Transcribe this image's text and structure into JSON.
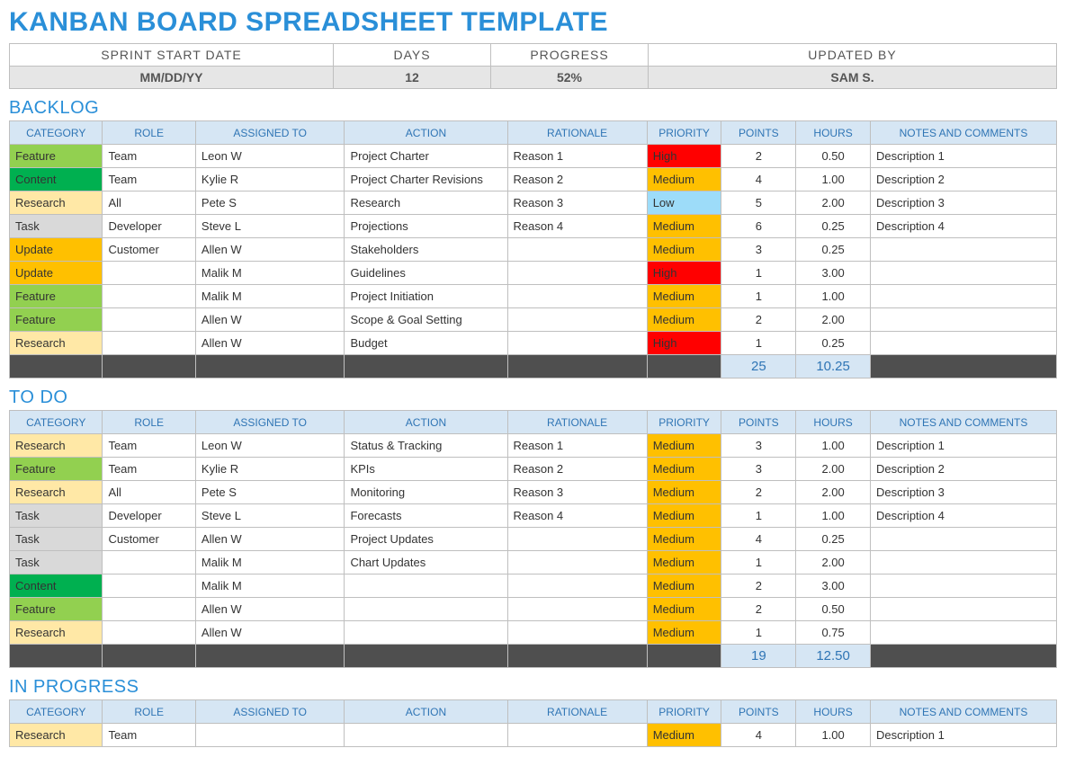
{
  "title": "KANBAN BOARD SPREADSHEET TEMPLATE",
  "meta": {
    "headers": [
      "SPRINT START DATE",
      "DAYS",
      "PROGRESS",
      "UPDATED BY"
    ],
    "values": [
      "MM/DD/YY",
      "12",
      "52%",
      "SAM S."
    ]
  },
  "columns": [
    "CATEGORY",
    "ROLE",
    "ASSIGNED TO",
    "ACTION",
    "RATIONALE",
    "PRIORITY",
    "POINTS",
    "HOURS",
    "NOTES AND COMMENTS"
  ],
  "categoryColors": {
    "Feature": "#92d050",
    "Content": "#00b050",
    "Research": "#ffe8a6",
    "Task": "#d9d9d9",
    "Update": "#ffc000"
  },
  "priorityColors": {
    "High": "#ff0000",
    "Medium": "#ffc000",
    "Low": "#9ddcf9"
  },
  "sections": [
    {
      "name": "BACKLOG",
      "rows": [
        {
          "category": "Feature",
          "role": "Team",
          "assigned": "Leon W",
          "action": "Project Charter",
          "rationale": "Reason 1",
          "priority": "High",
          "points": "2",
          "hours": "0.50",
          "notes": "Description 1"
        },
        {
          "category": "Content",
          "role": "Team",
          "assigned": "Kylie R",
          "action": "Project Charter Revisions",
          "rationale": "Reason 2",
          "priority": "Medium",
          "points": "4",
          "hours": "1.00",
          "notes": "Description 2"
        },
        {
          "category": "Research",
          "role": "All",
          "assigned": "Pete S",
          "action": "Research",
          "rationale": "Reason 3",
          "priority": "Low",
          "points": "5",
          "hours": "2.00",
          "notes": "Description 3"
        },
        {
          "category": "Task",
          "role": "Developer",
          "assigned": "Steve L",
          "action": "Projections",
          "rationale": "Reason 4",
          "priority": "Medium",
          "points": "6",
          "hours": "0.25",
          "notes": "Description 4"
        },
        {
          "category": "Update",
          "role": "Customer",
          "assigned": "Allen W",
          "action": "Stakeholders",
          "rationale": "",
          "priority": "Medium",
          "points": "3",
          "hours": "0.25",
          "notes": ""
        },
        {
          "category": "Update",
          "role": "",
          "assigned": "Malik M",
          "action": "Guidelines",
          "rationale": "",
          "priority": "High",
          "points": "1",
          "hours": "3.00",
          "notes": ""
        },
        {
          "category": "Feature",
          "role": "",
          "assigned": "Malik M",
          "action": "Project Initiation",
          "rationale": "",
          "priority": "Medium",
          "points": "1",
          "hours": "1.00",
          "notes": ""
        },
        {
          "category": "Feature",
          "role": "",
          "assigned": "Allen W",
          "action": "Scope & Goal Setting",
          "rationale": "",
          "priority": "Medium",
          "points": "2",
          "hours": "2.00",
          "notes": ""
        },
        {
          "category": "Research",
          "role": "",
          "assigned": "Allen W",
          "action": "Budget",
          "rationale": "",
          "priority": "High",
          "points": "1",
          "hours": "0.25",
          "notes": ""
        }
      ],
      "totals": {
        "points": "25",
        "hours": "10.25"
      }
    },
    {
      "name": "TO DO",
      "rows": [
        {
          "category": "Research",
          "role": "Team",
          "assigned": "Leon W",
          "action": "Status & Tracking",
          "rationale": "Reason 1",
          "priority": "Medium",
          "points": "3",
          "hours": "1.00",
          "notes": "Description 1"
        },
        {
          "category": "Feature",
          "role": "Team",
          "assigned": "Kylie R",
          "action": "KPIs",
          "rationale": "Reason 2",
          "priority": "Medium",
          "points": "3",
          "hours": "2.00",
          "notes": "Description 2"
        },
        {
          "category": "Research",
          "role": "All",
          "assigned": "Pete S",
          "action": "Monitoring",
          "rationale": "Reason 3",
          "priority": "Medium",
          "points": "2",
          "hours": "2.00",
          "notes": "Description 3"
        },
        {
          "category": "Task",
          "role": "Developer",
          "assigned": "Steve L",
          "action": "Forecasts",
          "rationale": "Reason 4",
          "priority": "Medium",
          "points": "1",
          "hours": "1.00",
          "notes": "Description 4"
        },
        {
          "category": "Task",
          "role": "Customer",
          "assigned": "Allen W",
          "action": "Project Updates",
          "rationale": "",
          "priority": "Medium",
          "points": "4",
          "hours": "0.25",
          "notes": ""
        },
        {
          "category": "Task",
          "role": "",
          "assigned": "Malik M",
          "action": "Chart Updates",
          "rationale": "",
          "priority": "Medium",
          "points": "1",
          "hours": "2.00",
          "notes": ""
        },
        {
          "category": "Content",
          "role": "",
          "assigned": "Malik M",
          "action": "",
          "rationale": "",
          "priority": "Medium",
          "points": "2",
          "hours": "3.00",
          "notes": ""
        },
        {
          "category": "Feature",
          "role": "",
          "assigned": "Allen W",
          "action": "",
          "rationale": "",
          "priority": "Medium",
          "points": "2",
          "hours": "0.50",
          "notes": ""
        },
        {
          "category": "Research",
          "role": "",
          "assigned": "Allen W",
          "action": "",
          "rationale": "",
          "priority": "Medium",
          "points": "1",
          "hours": "0.75",
          "notes": ""
        }
      ],
      "totals": {
        "points": "19",
        "hours": "12.50"
      }
    },
    {
      "name": "IN PROGRESS",
      "rows": [
        {
          "category": "Research",
          "role": "Team",
          "assigned": "",
          "action": "",
          "rationale": "",
          "priority": "Medium",
          "points": "4",
          "hours": "1.00",
          "notes": "Description 1"
        }
      ],
      "totals": null
    }
  ]
}
